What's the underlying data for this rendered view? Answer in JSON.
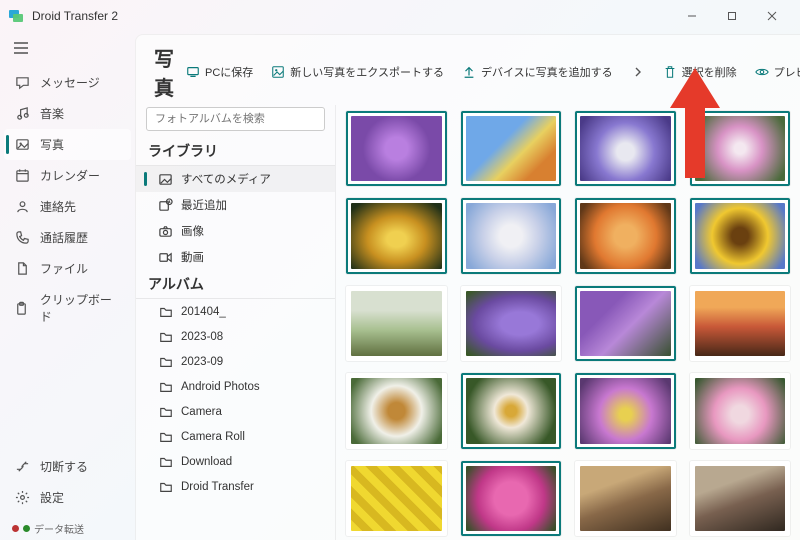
{
  "app": {
    "title": "Droid Transfer 2"
  },
  "win": {
    "min": "–",
    "max": "▢",
    "close": "✕"
  },
  "nav": {
    "items": [
      {
        "label": "メッセージ",
        "icon": "message-icon"
      },
      {
        "label": "音楽",
        "icon": "music-icon"
      },
      {
        "label": "写真",
        "icon": "photo-icon",
        "active": true
      },
      {
        "label": "カレンダー",
        "icon": "calendar-icon"
      },
      {
        "label": "連絡先",
        "icon": "contacts-icon"
      },
      {
        "label": "通話履歴",
        "icon": "calllog-icon"
      },
      {
        "label": "ファイル",
        "icon": "file-icon"
      },
      {
        "label": "クリップボード",
        "icon": "clipboard-icon"
      }
    ],
    "bottom": [
      {
        "label": "切断する",
        "icon": "disconnect-icon"
      },
      {
        "label": "設定",
        "icon": "settings-icon"
      }
    ],
    "status": "データ転送"
  },
  "page": {
    "title": "写真"
  },
  "toolbar": {
    "save_pc": "PCに保存",
    "export_new": "新しい写真をエクスポートする",
    "add_to_device": "デバイスに写真を追加する",
    "delete_sel": "選択を削除",
    "preview": "プレビュー"
  },
  "search": {
    "placeholder": "フォトアルバムを検索"
  },
  "library": {
    "head": "ライブラリ",
    "items": [
      {
        "label": "すべてのメディア",
        "icon": "allmedia-icon",
        "active": true
      },
      {
        "label": "最近追加",
        "icon": "recent-icon"
      },
      {
        "label": "画像",
        "icon": "camera-icon"
      },
      {
        "label": "動画",
        "icon": "video-icon"
      }
    ]
  },
  "albums": {
    "head": "アルバム",
    "items": [
      {
        "label": "201404_"
      },
      {
        "label": "2023-08"
      },
      {
        "label": "2023-09"
      },
      {
        "label": "Android Photos"
      },
      {
        "label": "Camera"
      },
      {
        "label": "Camera Roll"
      },
      {
        "label": "Download"
      },
      {
        "label": "Droid Transfer"
      }
    ]
  },
  "thumbs": [
    {
      "sel": true
    },
    {
      "sel": true
    },
    {
      "sel": true
    },
    {
      "sel": true
    },
    {
      "sel": true
    },
    {
      "sel": true
    },
    {
      "sel": true
    },
    {
      "sel": true
    },
    {
      "sel": false
    },
    {
      "sel": false
    },
    {
      "sel": true
    },
    {
      "sel": false
    },
    {
      "sel": false
    },
    {
      "sel": true
    },
    {
      "sel": true
    },
    {
      "sel": false
    },
    {
      "sel": false
    },
    {
      "sel": true
    },
    {
      "sel": false
    },
    {
      "sel": false
    }
  ]
}
